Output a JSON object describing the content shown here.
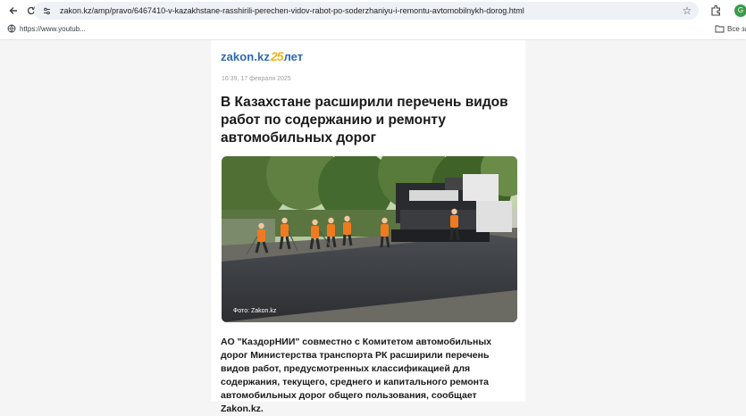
{
  "browser": {
    "url": "zakon.kz/amp/pravo/6467410-v-kazakhstane-rasshirili-perechen-vidov-rabot-po-soderzhaniyu-i-remontu-avtomobilnykh-dorog.html",
    "profile_initial": "G",
    "icons": [
      "back-arrow-icon",
      "reload-icon",
      "site-info-icon",
      "star-icon",
      "extensions-icon"
    ]
  },
  "bookmarks": {
    "item_label": "https://www.youtub...",
    "all_bookmarks_label": "Все за"
  },
  "site": {
    "logo_word": "zakon.kz",
    "logo_number": "25",
    "logo_suffix": "лет",
    "colors": {
      "brand_blue": "#2f68b5",
      "brand_gold": "#f0b31d"
    }
  },
  "article": {
    "timestamp": "16:39, 17 февраля 2025",
    "title": "В Казахстане расширили перечень видов работ по содержанию и ремонту автомобильных дорог",
    "photo_caption": "Фото: Zakon.kz",
    "lede": "АО \"КаздорНИИ\" совместно с Комитетом автомобильных дорог Министерства транспорта РК расширили перечень видов работ, предусмотренных классификацией для содержания, текущего, среднего и капитального ремонта автомобильных дорог общего пользования, сообщает Zakon.kz."
  }
}
